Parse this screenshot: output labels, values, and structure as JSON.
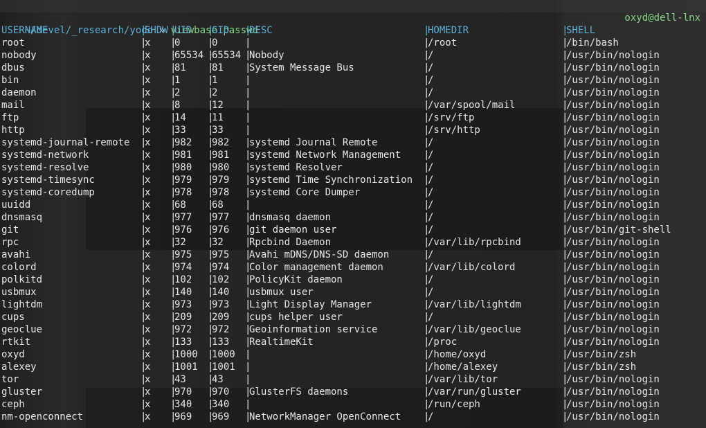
{
  "prompt": {
    "path": "~/devel/_research/yodo",
    "arrow": "»",
    "command": "viewbase passwd",
    "host": "oxyd@dell-lnx"
  },
  "table": {
    "headers": [
      "USERNAME",
      "SHDW",
      "UID",
      "GID",
      "DESC",
      "HOMEDIR",
      "SHELL"
    ],
    "rows": [
      [
        "root",
        "x",
        "0",
        "0",
        "",
        "/root",
        "/bin/bash"
      ],
      [
        "nobody",
        "x",
        "65534",
        "65534",
        "Nobody",
        "/",
        "/usr/bin/nologin"
      ],
      [
        "dbus",
        "x",
        "81",
        "81",
        "System Message Bus",
        "/",
        "/usr/bin/nologin"
      ],
      [
        "bin",
        "x",
        "1",
        "1",
        "",
        "/",
        "/usr/bin/nologin"
      ],
      [
        "daemon",
        "x",
        "2",
        "2",
        "",
        "/",
        "/usr/bin/nologin"
      ],
      [
        "mail",
        "x",
        "8",
        "12",
        "",
        "/var/spool/mail",
        "/usr/bin/nologin"
      ],
      [
        "ftp",
        "x",
        "14",
        "11",
        "",
        "/srv/ftp",
        "/usr/bin/nologin"
      ],
      [
        "http",
        "x",
        "33",
        "33",
        "",
        "/srv/http",
        "/usr/bin/nologin"
      ],
      [
        "systemd-journal-remote",
        "x",
        "982",
        "982",
        "systemd Journal Remote",
        "/",
        "/usr/bin/nologin"
      ],
      [
        "systemd-network",
        "x",
        "981",
        "981",
        "systemd Network Management",
        "/",
        "/usr/bin/nologin"
      ],
      [
        "systemd-resolve",
        "x",
        "980",
        "980",
        "systemd Resolver",
        "/",
        "/usr/bin/nologin"
      ],
      [
        "systemd-timesync",
        "x",
        "979",
        "979",
        "systemd Time Synchronization",
        "/",
        "/usr/bin/nologin"
      ],
      [
        "systemd-coredump",
        "x",
        "978",
        "978",
        "systemd Core Dumper",
        "/",
        "/usr/bin/nologin"
      ],
      [
        "uuidd",
        "x",
        "68",
        "68",
        "",
        "/",
        "/usr/bin/nologin"
      ],
      [
        "dnsmasq",
        "x",
        "977",
        "977",
        "dnsmasq daemon",
        "/",
        "/usr/bin/nologin"
      ],
      [
        "git",
        "x",
        "976",
        "976",
        "git daemon user",
        "/",
        "/usr/bin/git-shell"
      ],
      [
        "rpc",
        "x",
        "32",
        "32",
        "Rpcbind Daemon",
        "/var/lib/rpcbind",
        "/usr/bin/nologin"
      ],
      [
        "avahi",
        "x",
        "975",
        "975",
        "Avahi mDNS/DNS-SD daemon",
        "/",
        "/usr/bin/nologin"
      ],
      [
        "colord",
        "x",
        "974",
        "974",
        "Color management daemon",
        "/var/lib/colord",
        "/usr/bin/nologin"
      ],
      [
        "polkitd",
        "x",
        "102",
        "102",
        "PolicyKit daemon",
        "/",
        "/usr/bin/nologin"
      ],
      [
        "usbmux",
        "x",
        "140",
        "140",
        "usbmux user",
        "/",
        "/usr/bin/nologin"
      ],
      [
        "lightdm",
        "x",
        "973",
        "973",
        "Light Display Manager",
        "/var/lib/lightdm",
        "/usr/bin/nologin"
      ],
      [
        "cups",
        "x",
        "209",
        "209",
        "cups helper user",
        "/",
        "/usr/bin/nologin"
      ],
      [
        "geoclue",
        "x",
        "972",
        "972",
        "Geoinformation service",
        "/var/lib/geoclue",
        "/usr/bin/nologin"
      ],
      [
        "rtkit",
        "x",
        "133",
        "133",
        "RealtimeKit",
        "/proc",
        "/usr/bin/nologin"
      ],
      [
        "oxyd",
        "x",
        "1000",
        "1000",
        "",
        "/home/oxyd",
        "/usr/bin/zsh"
      ],
      [
        "alexey",
        "x",
        "1001",
        "1001",
        "",
        "/home/alexey",
        "/usr/bin/zsh"
      ],
      [
        "tor",
        "x",
        "43",
        "43",
        "",
        "/var/lib/tor",
        "/usr/bin/nologin"
      ],
      [
        "gluster",
        "x",
        "970",
        "970",
        "GlusterFS daemons",
        "/var/run/gluster",
        "/usr/bin/nologin"
      ],
      [
        "ceph",
        "x",
        "340",
        "340",
        "",
        "/run/ceph",
        "/usr/bin/nologin"
      ],
      [
        "nm-openconnect",
        "x",
        "969",
        "969",
        "NetworkManager OpenConnect",
        "/",
        "/usr/bin/nologin"
      ]
    ]
  },
  "colors": {
    "path": "#5fafd7",
    "command": "#87d787",
    "host": "#87d787",
    "text": "#e6e6e6"
  }
}
